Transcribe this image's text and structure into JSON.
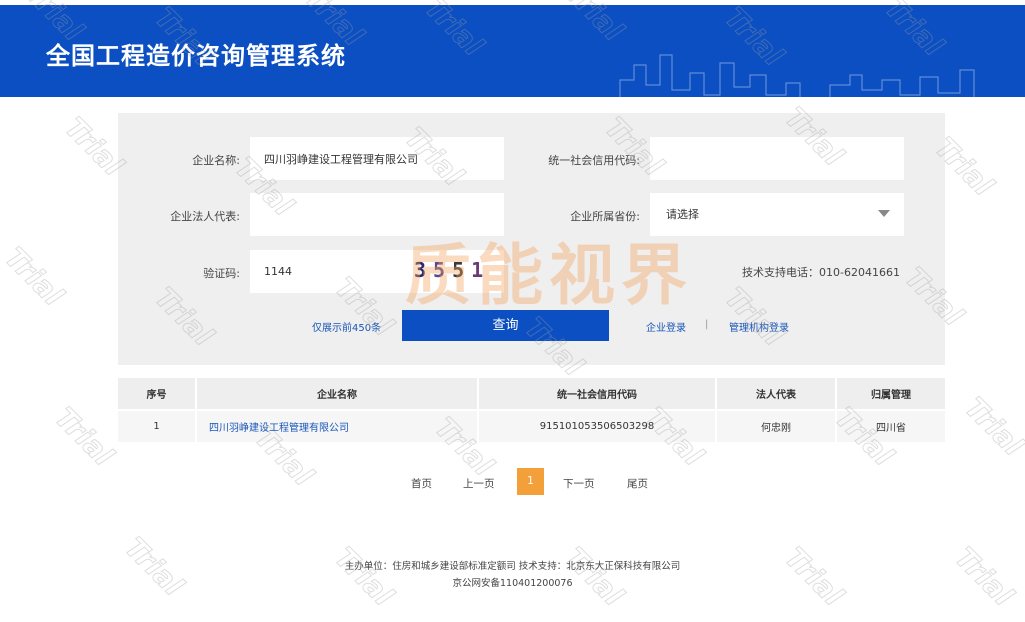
{
  "header": {
    "title": "全国工程造价咨询管理系统"
  },
  "form": {
    "company_name_label": "企业名称:",
    "company_name_value": "四川羽峥建设工程管理有限公司",
    "credit_code_label": "统一社会信用代码:",
    "credit_code_value": "",
    "legal_rep_label": "企业法人代表:",
    "legal_rep_value": "",
    "province_label": "企业所属省份:",
    "province_selected": "请选择",
    "captcha_label": "验证码:",
    "captcha_value": "1144",
    "captcha_image": [
      "3",
      "5",
      "5",
      "1"
    ],
    "support": "技术支持电话：010-62041661",
    "limit_note": "仅展示前450条",
    "query_button": "查询",
    "company_login": "企业登录",
    "separator": "|",
    "admin_login": "管理机构登录"
  },
  "table": {
    "headers": [
      "序号",
      "企业名称",
      "统一社会信用代码",
      "法人代表",
      "归属管理"
    ],
    "rows": [
      [
        "1",
        "四川羽峥建设工程管理有限公司",
        "915101053506503298",
        "何忠刚",
        "四川省"
      ]
    ]
  },
  "pager": {
    "first": "首页",
    "prev": "上一页",
    "current": "1",
    "next": "下一页",
    "last": "尾页"
  },
  "footer": {
    "line1": "主办单位：住房和城乡建设部标准定额司 技术支持：北京东大正保科技有限公司",
    "line2": "京公网安备110401200076"
  },
  "watermark": {
    "big": "质能视界",
    "trial": "Trial"
  },
  "colors": {
    "brand": "#0b4fc2",
    "pager_current": "#f4a03a",
    "link": "#1a56b8"
  }
}
